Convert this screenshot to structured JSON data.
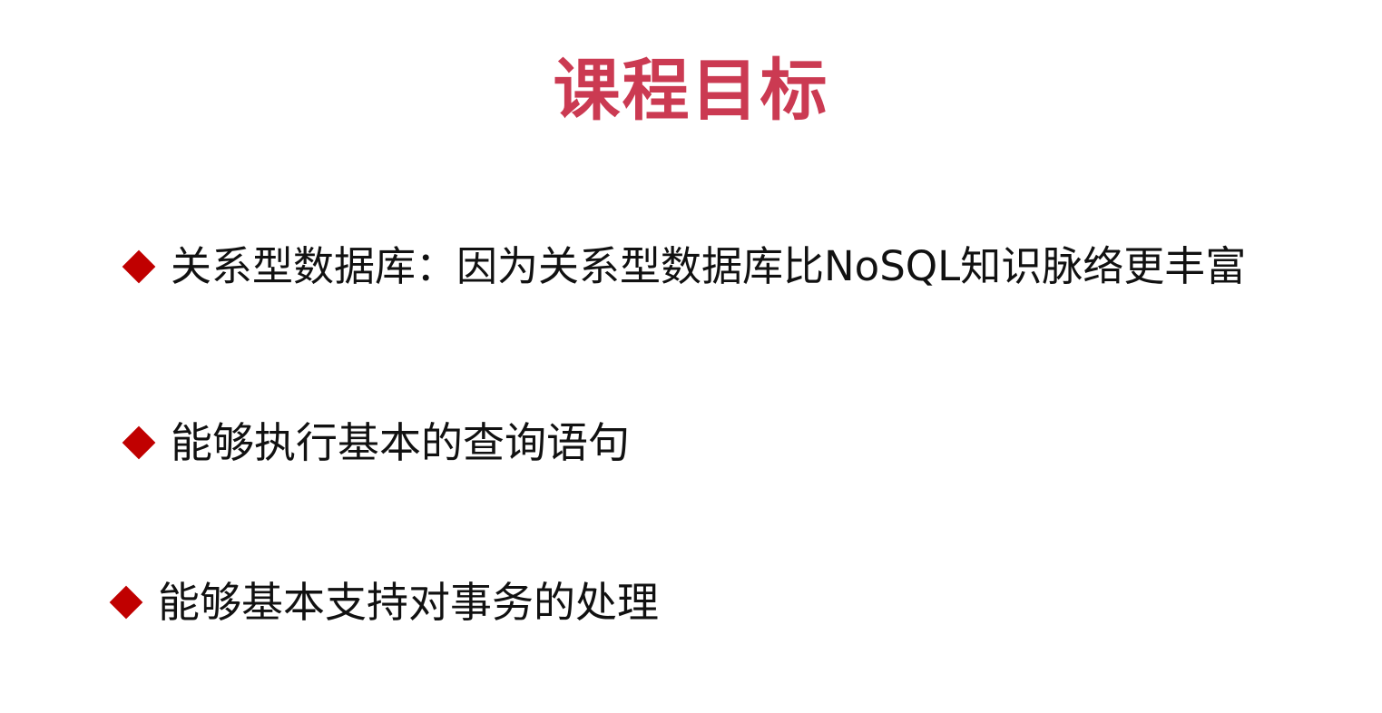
{
  "slide": {
    "title": "课程目标",
    "title_color": "#cb3a52",
    "bullet_color": "#c00000",
    "bullet_icon": "diamond-icon",
    "bullets": [
      "关系型数据库：因为关系型数据库比NoSQL知识脉络更丰富",
      "能够执行基本的查询语句",
      "能够基本支持对事务的处理"
    ]
  }
}
